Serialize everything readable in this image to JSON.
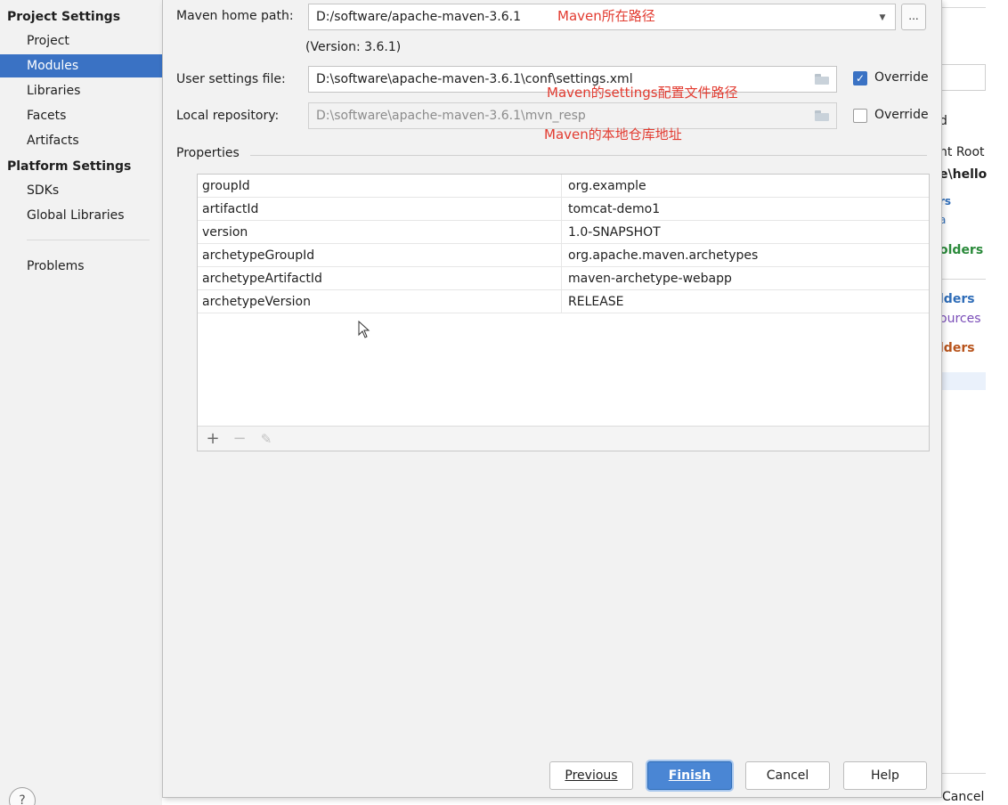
{
  "sidebar": {
    "project_settings_header": "Project Settings",
    "project_items": [
      "Project",
      "Modules",
      "Libraries",
      "Facets",
      "Artifacts"
    ],
    "platform_settings_header": "Platform Settings",
    "platform_items": [
      "SDKs",
      "Global Libraries"
    ],
    "problems": "Problems",
    "selected": "Modules",
    "help_glyph": "?"
  },
  "background_panel": {
    "fragments": [
      "d",
      "nt Root",
      "e\\hello",
      "rs",
      "a",
      "olders",
      "lders",
      "ources",
      "lders"
    ],
    "cancel_label": "Cancel"
  },
  "maven": {
    "home_label": "Maven home path:",
    "home_value": "D:/software/apache-maven-3.6.1",
    "version_text": "(Version: 3.6.1)",
    "browse_label": "...",
    "user_settings_label": "User settings file:",
    "user_settings_value": "D:\\software\\apache-maven-3.6.1\\conf\\settings.xml",
    "user_settings_override": true,
    "local_repo_label": "Local repository:",
    "local_repo_value": "D:\\software\\apache-maven-3.6.1\\mvn_resp",
    "local_repo_override": false,
    "override_label": "Override"
  },
  "annotations": {
    "home": "Maven所在路径",
    "settings": "Maven的settings配置文件路径",
    "repo": "Maven的本地仓库地址"
  },
  "properties": {
    "title": "Properties",
    "rows": [
      {
        "key": "groupId",
        "value": "org.example"
      },
      {
        "key": "artifactId",
        "value": "tomcat-demo1"
      },
      {
        "key": "version",
        "value": "1.0-SNAPSHOT"
      },
      {
        "key": "archetypeGroupId",
        "value": "org.apache.maven.archetypes"
      },
      {
        "key": "archetypeArtifactId",
        "value": "maven-archetype-webapp"
      },
      {
        "key": "archetypeVersion",
        "value": "RELEASE"
      }
    ],
    "toolbar": {
      "add": "+",
      "remove": "−",
      "edit": "✎"
    }
  },
  "buttons": {
    "previous": "Previous",
    "finish": "Finish",
    "cancel": "Cancel",
    "help": "Help"
  },
  "colors": {
    "selection": "#3a72c4",
    "annotation": "#e23b30",
    "primary_button": "#4a86d4"
  }
}
